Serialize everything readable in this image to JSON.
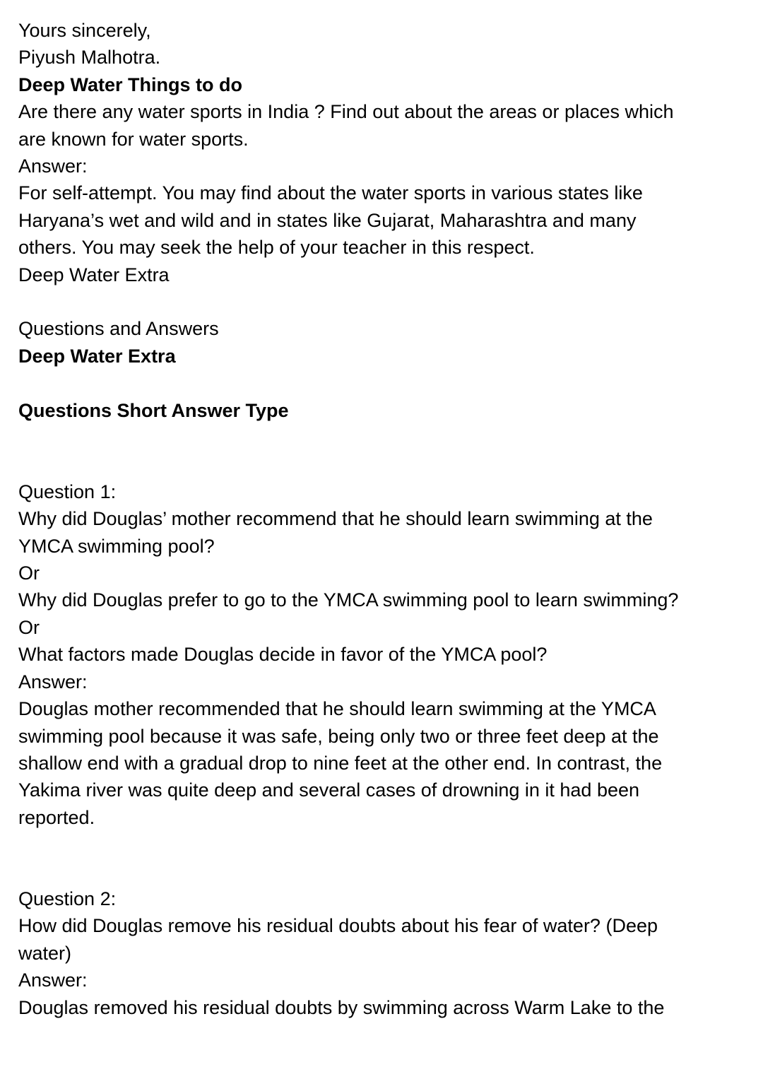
{
  "closing": {
    "salutation": "Yours sincerely,",
    "signature": "Piyush Malhotra."
  },
  "things_to_do": {
    "heading": "Deep Water Things to do",
    "question_lines": [
      "Are there any water sports in India ? Find out about the areas or places which",
      "are known for water sports."
    ],
    "answer_label": "Answer:",
    "answer_lines": [
      "For self-attempt. You may find about the water sports in various states like",
      "Haryana’s wet and wild and in states like Gujarat, Maharashtra and many",
      "others. You may seek the help of your teacher in this respect."
    ]
  },
  "extra_label": "Deep Water Extra",
  "qa_label": "Questions and Answers",
  "extra_heading": "Deep Water Extra",
  "section_heading": "Questions Short Answer Type",
  "questions": [
    {
      "number_label": "Question 1:",
      "prompt_lines": [
        "Why did Douglas’ mother recommend that he should learn swimming at the",
        "YMCA swimming pool?",
        "Or",
        "Why did Douglas prefer to go to the YMCA swimming pool to learn swimming?",
        "Or",
        "What factors made Douglas decide in favor of the YMCA pool?"
      ],
      "answer_label": "Answer:",
      "answer_lines": [
        "Douglas mother recommended that he should learn swimming at the YMCA",
        "swimming pool because it was safe, being only two or three feet deep at the",
        "shallow end with a gradual drop to nine feet at the other end. In contrast, the",
        "Yakima river was quite deep and several cases of drowning in it had been",
        "reported."
      ]
    },
    {
      "number_label": "Question 2:",
      "prompt_lines": [
        "How did Douglas remove his residual doubts about his fear of water? (Deep",
        "water)"
      ],
      "answer_label": "Answer:",
      "answer_lines": [
        "Douglas removed his residual doubts by swimming across Warm Lake to the"
      ]
    }
  ]
}
